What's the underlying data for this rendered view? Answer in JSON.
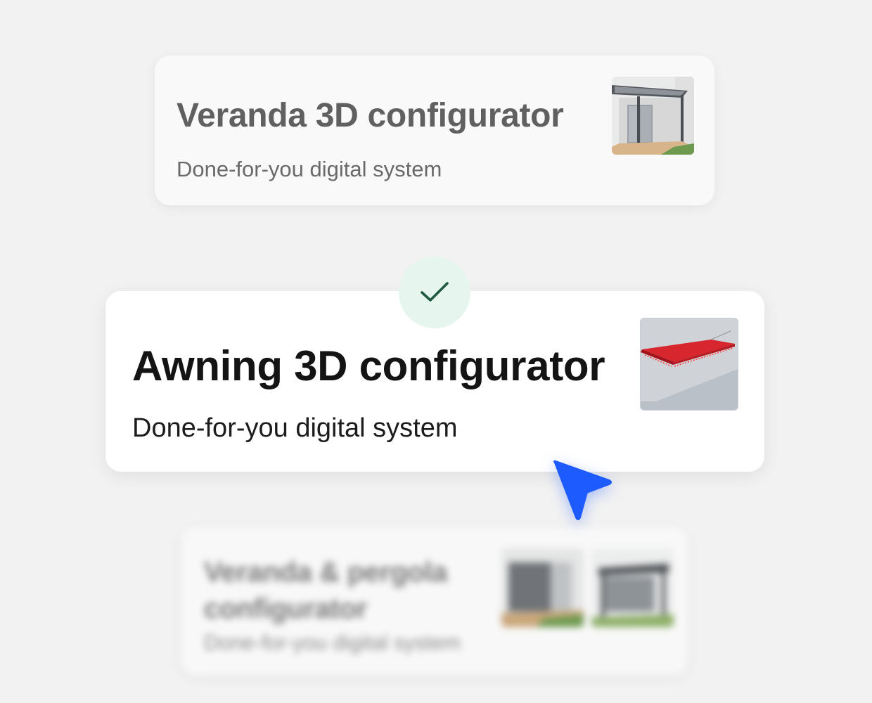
{
  "cards": [
    {
      "id": "veranda",
      "title": "Veranda 3D configurator",
      "subtitle": "Done-for-you digital system",
      "state": "default"
    },
    {
      "id": "awning",
      "title": "Awning 3D configurator",
      "subtitle": "Done-for-you digital system",
      "state": "selected"
    },
    {
      "id": "pergola",
      "title": "Veranda & pergola configurator",
      "subtitle": "Done-for-you digital system",
      "state": "blurred"
    }
  ],
  "icons": {
    "check": "check-icon",
    "cursor": "cursor-pointer-icon"
  },
  "colors": {
    "background": "#f2f2f2",
    "check_badge_bg": "#e6f5ee",
    "check_stroke": "#1f5a3f",
    "cursor": "#1e5bff",
    "awning_fabric": "#d8262e"
  }
}
